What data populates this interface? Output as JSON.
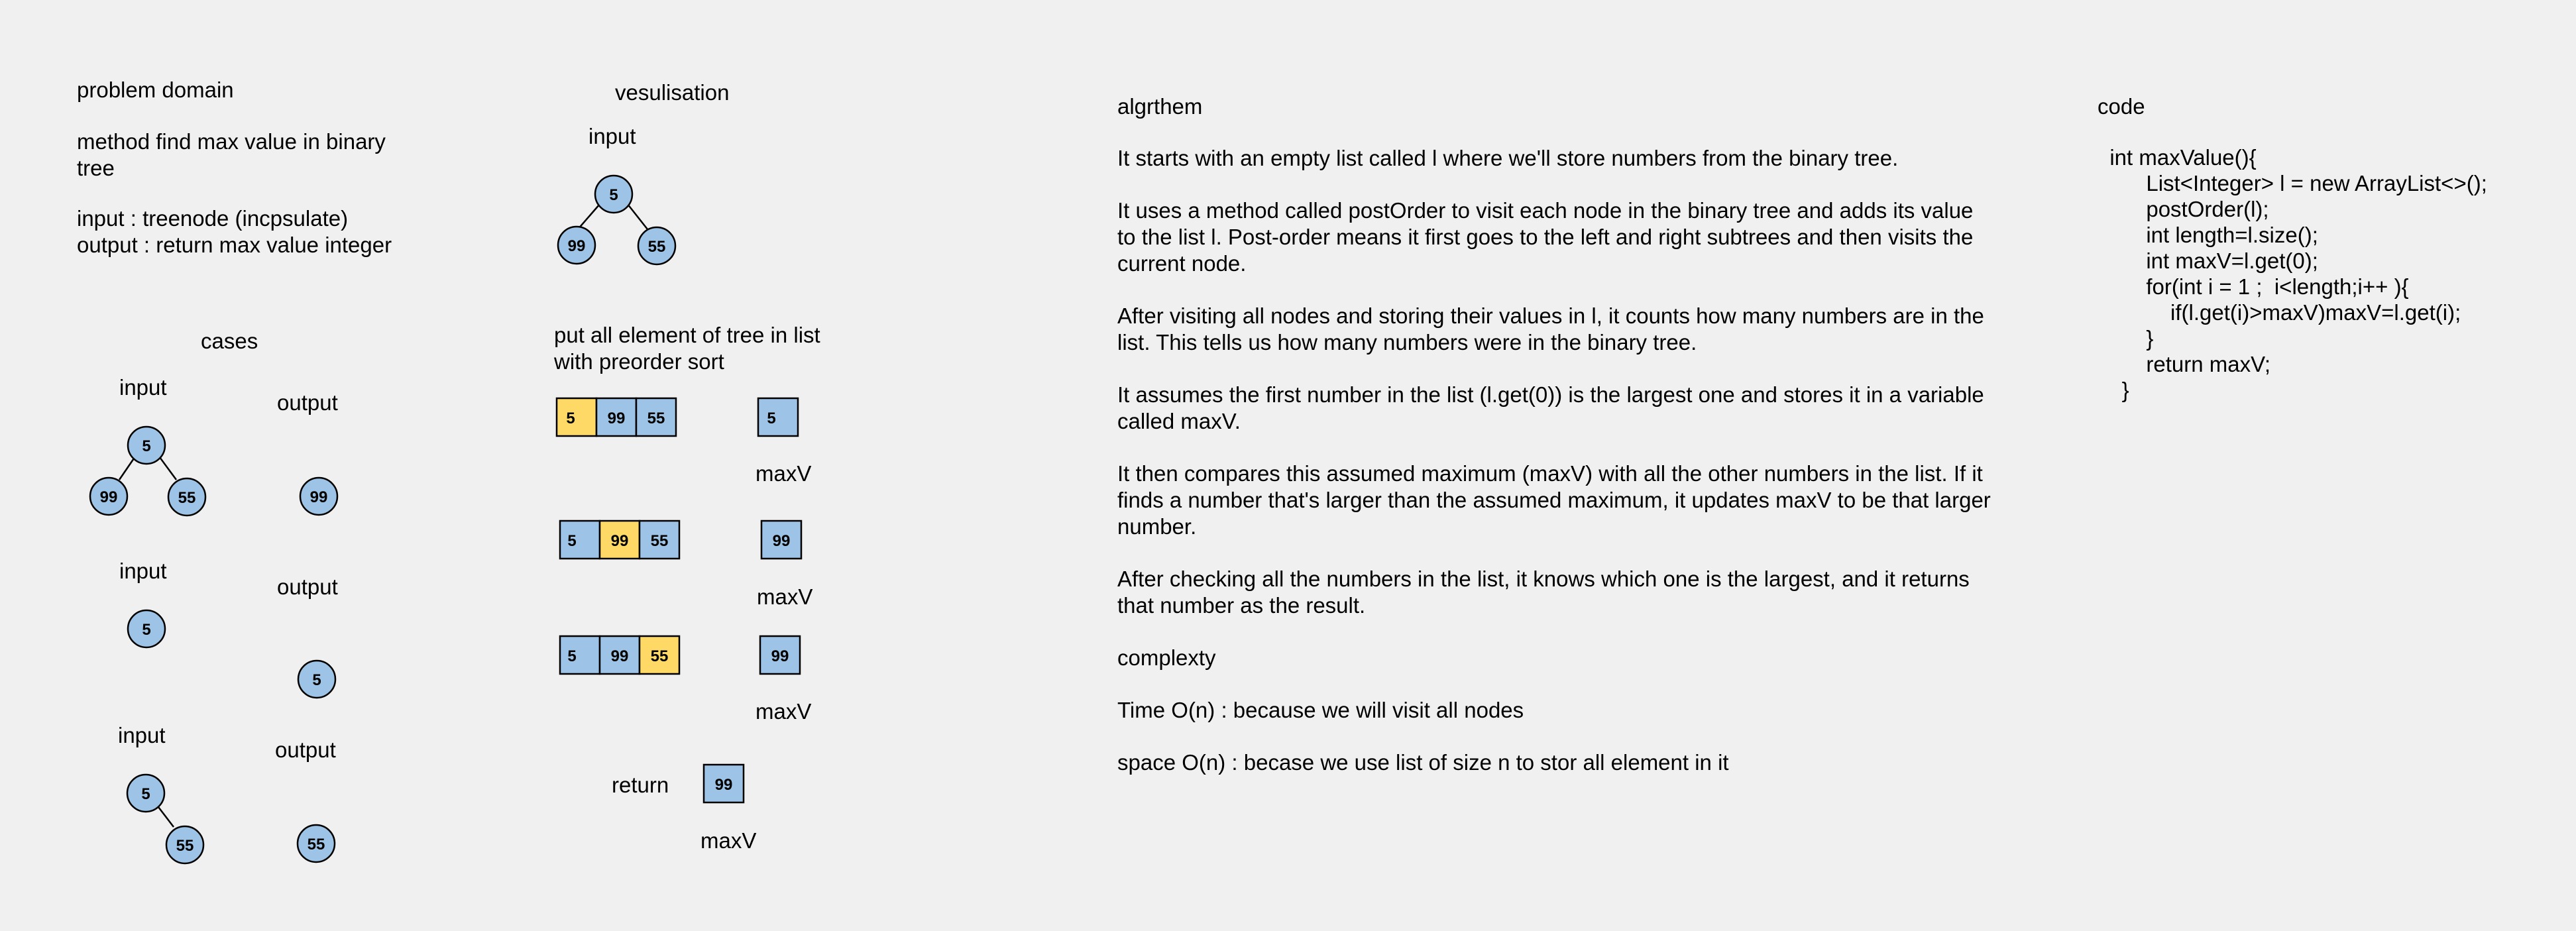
{
  "problem": {
    "title": "problem domain",
    "method": "method find max value in binary tree",
    "input": "input : treenode (incpsulate)",
    "output": "output : return max value integer"
  },
  "cases": {
    "title": "cases",
    "input_label": "input",
    "output_label": "output",
    "case1": {
      "tree": [
        "5",
        "99",
        "55"
      ],
      "result": "99"
    },
    "case2": {
      "tree": [
        "5"
      ],
      "result": "5"
    },
    "case3": {
      "tree": [
        "5",
        "55"
      ],
      "result": "55"
    }
  },
  "vis": {
    "title": "vesulisation",
    "input_label": "input",
    "tree": [
      "5",
      "99",
      "55"
    ],
    "step_text": "put all element of tree in list with preorder sort",
    "list": [
      "5",
      "99",
      "55"
    ],
    "maxv_label": "maxV",
    "steps": [
      {
        "highlight": 0,
        "maxv": "5"
      },
      {
        "highlight": 1,
        "maxv": "99"
      },
      {
        "highlight": 2,
        "maxv": "99"
      }
    ],
    "return_label": "return",
    "return_value": "99"
  },
  "algorithm": {
    "title": "algrthem",
    "paragraphs": [
      "It starts with an empty list called l where we'll store numbers from the binary tree.",
      "It uses a method called postOrder to visit each node in the binary tree and adds its value to the list l. Post-order means it first goes to the left and right subtrees and then visits the current node.",
      "After visiting all nodes and storing their values in l, it counts how many numbers are in the list. This tells us how many numbers were in the binary tree.",
      "It assumes the first number in the list (l.get(0)) is the largest one and stores it in a variable called maxV.",
      "It then compares this assumed maximum (maxV) with all the other numbers in the list. If it finds a number that's larger than the assumed maximum, it updates maxV to be that larger number.",
      "After checking all the numbers in the list, it knows which one is the largest, and it returns that number as the result."
    ],
    "complexity_title": "complexty",
    "time": "Time O(n) : because we will visit all nodes",
    "space": "space O(n) : becase we use list of size n to stor all element in it"
  },
  "code": {
    "title": "code",
    "lines": [
      "  int maxValue(){",
      "        List<Integer> l = new ArrayList<>();",
      "        postOrder(l);",
      "        int length=l.size();",
      "        int maxV=l.get(0);",
      "        for(int i = 1 ;  i<length;i++ ){",
      "            if(l.get(i)>maxV)maxV=l.get(i);",
      "        }",
      "        return maxV;",
      "    }"
    ]
  }
}
